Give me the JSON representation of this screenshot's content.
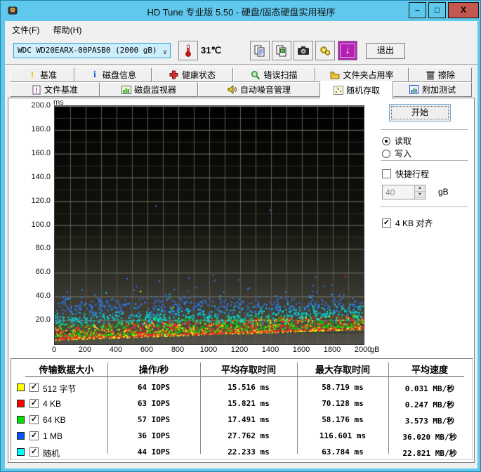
{
  "window": {
    "title": "HD Tune 专业版 5.50 - 硬盘/固态硬盘实用程序",
    "buttons": {
      "minimize": "–",
      "maximize": "□",
      "close": "X"
    }
  },
  "menu": {
    "file": "文件(F)",
    "help": "帮助(H)"
  },
  "toolbar": {
    "drive_value": "WDC WD20EARX-00PASB0  (2000 gB)",
    "temperature": "31℃",
    "exit_label": "退出",
    "update_glyph": "↓"
  },
  "tabs": {
    "row1": [
      {
        "label": "基准",
        "icon": "benchmark-icon"
      },
      {
        "label": "磁盘信息",
        "icon": "disk-info-icon"
      },
      {
        "label": "健康状态",
        "icon": "health-icon"
      },
      {
        "label": "错误扫描",
        "icon": "error-scan-icon"
      },
      {
        "label": "文件夹占用率",
        "icon": "folder-usage-icon"
      },
      {
        "label": "擦除",
        "icon": "erase-icon"
      }
    ],
    "row2": [
      {
        "label": "文件基准",
        "icon": "file-benchmark-icon"
      },
      {
        "label": "磁盘监视器",
        "icon": "disk-monitor-icon"
      },
      {
        "label": "自动噪音管理",
        "icon": "aam-icon"
      },
      {
        "label": "随机存取",
        "icon": "random-access-icon"
      },
      {
        "label": "附加测试",
        "icon": "extra-tests-icon"
      }
    ],
    "active": "随机存取"
  },
  "controls": {
    "start_label": "开始",
    "read_label": "读取",
    "write_label": "写入",
    "read_selected": true,
    "short_stroke_label": "快捷行程",
    "short_stroke_checked": false,
    "capacity_value": "40",
    "capacity_unit": "gB",
    "align_label": "4 KB 对齐",
    "align_checked": true,
    "check_glyph": "✓"
  },
  "chart_data": {
    "type": "scatter",
    "title": "Random access time vs disk position",
    "ylabel": "ms",
    "xlabel": "gB",
    "xlim": [
      0,
      2000
    ],
    "ylim": [
      0,
      200
    ],
    "x_ticks": [
      "0",
      "200",
      "400",
      "600",
      "800",
      "1000",
      "1200",
      "1400",
      "1600",
      "1800",
      "2000"
    ],
    "y_ticks": [
      "200.0",
      "180.0",
      "160.0",
      "140.0",
      "120.0",
      "100.0",
      "80.0",
      "60.0",
      "40.0",
      "20.0"
    ],
    "grid": {
      "x_minor_step": 100,
      "y_major_step": 20,
      "y_minor_step": 10
    },
    "background_gradient": [
      "#000000",
      "#15150f",
      "#53524a"
    ],
    "series": [
      {
        "name": "512 字节",
        "color": "#ffff00",
        "iops": 64,
        "avg_ms": 15.516,
        "max_ms": 58.719,
        "gen": {
          "kind": "low",
          "start": 4.0,
          "end": 13.0,
          "spread": 12,
          "count": 640,
          "outlier_p": 0.004,
          "outlier_hi": 58
        }
      },
      {
        "name": "64 KB",
        "color": "#00d800",
        "iops": 57,
        "avg_ms": 17.491,
        "max_ms": 58.176,
        "gen": {
          "kind": "low",
          "start": 6.5,
          "end": 15.5,
          "spread": 12,
          "count": 600,
          "outlier_p": 0.005,
          "outlier_hi": 56
        }
      },
      {
        "name": "4 KB",
        "color": "#ff2a2a",
        "iops": 63,
        "avg_ms": 15.821,
        "max_ms": 70.128,
        "gen": {
          "kind": "low",
          "start": 4.5,
          "end": 13.5,
          "spread": 12,
          "count": 620,
          "outlier_p": 0.004,
          "outlier_hi": 58
        }
      },
      {
        "name": "随机",
        "color": "#00e0e0",
        "iops": 44,
        "avg_ms": 22.233,
        "max_ms": 63.784,
        "gen": {
          "kind": "band",
          "lo0": 14,
          "lo1": 19,
          "width": 16,
          "count": 520,
          "outlier_p": 0.01,
          "outlier_hi": 46
        }
      },
      {
        "name": "1 MB",
        "color": "#2f78f0",
        "iops": 36,
        "avg_ms": 27.762,
        "max_ms": 116.601,
        "gen": {
          "kind": "band",
          "lo0": 21,
          "lo1": 24,
          "width": 21,
          "count": 470,
          "outlier_p": 0.06,
          "outlier_hi": 60
        }
      }
    ],
    "fixed_outliers": [
      {
        "color": "#2f78f0",
        "x": 650,
        "y": 116.5
      },
      {
        "color": "#2f78f0",
        "x": 1390,
        "y": 113.0
      }
    ]
  },
  "table": {
    "headers": [
      "传输数据大小",
      "操作/秒",
      "平均存取时间",
      "最大存取时间",
      "平均速度"
    ],
    "rows": [
      {
        "color": "#ffff00",
        "label": "512 字节",
        "checked": true,
        "ops": "64 IOPS",
        "avg": "15.516 ms",
        "max": "58.719 ms",
        "speed": "0.031 MB/秒"
      },
      {
        "color": "#ff0000",
        "label": "4 KB",
        "checked": true,
        "ops": "63 IOPS",
        "avg": "15.821 ms",
        "max": "70.128 ms",
        "speed": "0.247 MB/秒"
      },
      {
        "color": "#00e000",
        "label": "64 KB",
        "checked": true,
        "ops": "57 IOPS",
        "avg": "17.491 ms",
        "max": "58.176 ms",
        "speed": "3.573 MB/秒"
      },
      {
        "color": "#0055ff",
        "label": "1 MB",
        "checked": true,
        "ops": "36 IOPS",
        "avg": "27.762 ms",
        "max": "116.601 ms",
        "speed": "36.020 MB/秒"
      },
      {
        "color": "#00ffff",
        "label": "随机",
        "checked": true,
        "ops": "44 IOPS",
        "avg": "22.233 ms",
        "max": "63.784 ms",
        "speed": "22.821 MB/秒"
      }
    ]
  }
}
